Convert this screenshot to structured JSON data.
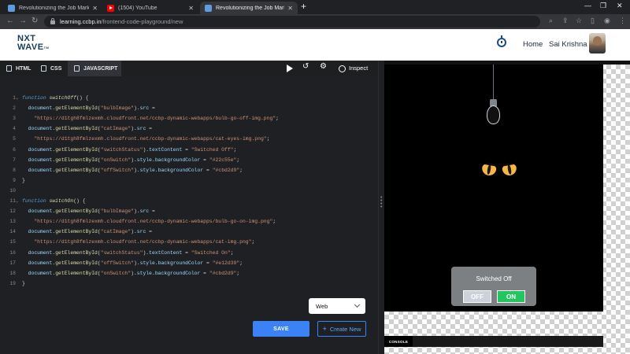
{
  "browser": {
    "tabs": [
      {
        "title": "Revolutionizing the Job Market |",
        "favicon": "ccbp-icon",
        "active": false
      },
      {
        "title": "(1504) YouTube",
        "favicon": "youtube-icon",
        "active": false
      },
      {
        "title": "Revolutionizing the Job Market |",
        "favicon": "ccbp-icon",
        "active": true
      }
    ],
    "url_host": "learning.ccbp.in",
    "url_path": "/frontend-code-playground/new"
  },
  "header": {
    "logo_line1": "NXT",
    "logo_line2": "WAVE",
    "logo_tm": "TM",
    "home_label": "Home",
    "user_name": "Sai Krishna"
  },
  "editor": {
    "tabs": [
      {
        "label": "HTML",
        "active": false
      },
      {
        "label": "CSS",
        "active": false
      },
      {
        "label": "JAVASCRIPT",
        "active": true
      }
    ],
    "inspect_label": "Inspect",
    "language_selected": "Web",
    "save_label": "SAVE",
    "create_new_label": "Create New",
    "lines": [
      {
        "n": "1",
        "fold": "⌄",
        "tokens": [
          [
            "kw",
            "function "
          ],
          [
            "fn",
            "switchOff"
          ],
          [
            "pl",
            "() {"
          ]
        ]
      },
      {
        "n": "2",
        "fold": "",
        "tokens": [
          [
            "pl",
            "  "
          ],
          [
            "vr",
            "document"
          ],
          [
            "pl",
            "."
          ],
          [
            "mt",
            "getElementById"
          ],
          [
            "pl",
            "("
          ],
          [
            "st",
            "\"bulbImage\""
          ],
          [
            "pl",
            ")."
          ],
          [
            "vr",
            "src"
          ],
          [
            "pl",
            " ="
          ]
        ]
      },
      {
        "n": "3",
        "fold": "",
        "tokens": [
          [
            "pl",
            "    "
          ],
          [
            "st",
            "\"https://d1tgh8fmlzexmh.cloudfront.net/ccbp-dynamic-webapps/bulb-go-off-img.png\""
          ],
          [
            "pl",
            ";"
          ]
        ]
      },
      {
        "n": "4",
        "fold": "",
        "tokens": [
          [
            "pl",
            "  "
          ],
          [
            "vr",
            "document"
          ],
          [
            "pl",
            "."
          ],
          [
            "mt",
            "getElementById"
          ],
          [
            "pl",
            "("
          ],
          [
            "st",
            "\"catImage\""
          ],
          [
            "pl",
            ")."
          ],
          [
            "vr",
            "src"
          ],
          [
            "pl",
            " ="
          ]
        ]
      },
      {
        "n": "5",
        "fold": "",
        "tokens": [
          [
            "pl",
            "    "
          ],
          [
            "st",
            "\"https://d1tgh8fmlzexmh.cloudfront.net/ccbp-dynamic-webapps/cat-eyes-img.png\""
          ],
          [
            "pl",
            ";"
          ]
        ]
      },
      {
        "n": "6",
        "fold": "",
        "tokens": [
          [
            "pl",
            "  "
          ],
          [
            "vr",
            "document"
          ],
          [
            "pl",
            "."
          ],
          [
            "mt",
            "getElementById"
          ],
          [
            "pl",
            "("
          ],
          [
            "st",
            "\"switchStatus\""
          ],
          [
            "pl",
            ")."
          ],
          [
            "vr",
            "textContent"
          ],
          [
            "pl",
            " = "
          ],
          [
            "st",
            "\"Switched Off\""
          ],
          [
            "pl",
            ";"
          ]
        ]
      },
      {
        "n": "7",
        "fold": "",
        "tokens": [
          [
            "pl",
            "  "
          ],
          [
            "vr",
            "document"
          ],
          [
            "pl",
            "."
          ],
          [
            "mt",
            "getElementById"
          ],
          [
            "pl",
            "("
          ],
          [
            "st",
            "\"onSwitch\""
          ],
          [
            "pl",
            ")."
          ],
          [
            "vr",
            "style"
          ],
          [
            "pl",
            "."
          ],
          [
            "vr",
            "backgroundColor"
          ],
          [
            "pl",
            " = "
          ],
          [
            "st",
            "\"#22c55e\""
          ],
          [
            "pl",
            ";"
          ]
        ]
      },
      {
        "n": "8",
        "fold": "",
        "tokens": [
          [
            "pl",
            "  "
          ],
          [
            "vr",
            "document"
          ],
          [
            "pl",
            "."
          ],
          [
            "mt",
            "getElementById"
          ],
          [
            "pl",
            "("
          ],
          [
            "st",
            "\"offSwitch\""
          ],
          [
            "pl",
            ")."
          ],
          [
            "vr",
            "style"
          ],
          [
            "pl",
            "."
          ],
          [
            "vr",
            "backgroundColor"
          ],
          [
            "pl",
            " = "
          ],
          [
            "st",
            "\"#cbd2d9\""
          ],
          [
            "pl",
            ";"
          ]
        ]
      },
      {
        "n": "9",
        "fold": "",
        "tokens": [
          [
            "pl",
            "}"
          ]
        ]
      },
      {
        "n": "10",
        "fold": "",
        "tokens": []
      },
      {
        "n": "11",
        "fold": "⌄",
        "tokens": [
          [
            "kw",
            "function "
          ],
          [
            "fn",
            "switchOn"
          ],
          [
            "pl",
            "() {"
          ]
        ]
      },
      {
        "n": "12",
        "fold": "",
        "tokens": [
          [
            "pl",
            "  "
          ],
          [
            "vr",
            "document"
          ],
          [
            "pl",
            "."
          ],
          [
            "mt",
            "getElementById"
          ],
          [
            "pl",
            "("
          ],
          [
            "st",
            "\"bulbImage\""
          ],
          [
            "pl",
            ")."
          ],
          [
            "vr",
            "src"
          ],
          [
            "pl",
            " ="
          ]
        ]
      },
      {
        "n": "13",
        "fold": "",
        "tokens": [
          [
            "pl",
            "    "
          ],
          [
            "st",
            "\"https://d1tgh8fmlzexmh.cloudfront.net/ccbp-dynamic-webapps/bulb-go-on-img.png\""
          ],
          [
            "pl",
            ";"
          ]
        ]
      },
      {
        "n": "14",
        "fold": "",
        "tokens": [
          [
            "pl",
            "  "
          ],
          [
            "vr",
            "document"
          ],
          [
            "pl",
            "."
          ],
          [
            "mt",
            "getElementById"
          ],
          [
            "pl",
            "("
          ],
          [
            "st",
            "\"catImage\""
          ],
          [
            "pl",
            ")."
          ],
          [
            "vr",
            "src"
          ],
          [
            "pl",
            " ="
          ]
        ]
      },
      {
        "n": "15",
        "fold": "",
        "tokens": [
          [
            "pl",
            "    "
          ],
          [
            "st",
            "\"https://d1tgh8fmlzexmh.cloudfront.net/ccbp-dynamic-webapps/cat-img.png\""
          ],
          [
            "pl",
            ";"
          ]
        ]
      },
      {
        "n": "16",
        "fold": "",
        "tokens": [
          [
            "pl",
            "  "
          ],
          [
            "vr",
            "document"
          ],
          [
            "pl",
            "."
          ],
          [
            "mt",
            "getElementById"
          ],
          [
            "pl",
            "("
          ],
          [
            "st",
            "\"switchStatus\""
          ],
          [
            "pl",
            ")."
          ],
          [
            "vr",
            "textContent"
          ],
          [
            "pl",
            " = "
          ],
          [
            "st",
            "\"Switched On\""
          ],
          [
            "pl",
            ";"
          ]
        ]
      },
      {
        "n": "17",
        "fold": "",
        "tokens": [
          [
            "pl",
            "  "
          ],
          [
            "vr",
            "document"
          ],
          [
            "pl",
            "."
          ],
          [
            "mt",
            "getElementById"
          ],
          [
            "pl",
            "("
          ],
          [
            "st",
            "\"offSwitch\""
          ],
          [
            "pl",
            ")."
          ],
          [
            "vr",
            "style"
          ],
          [
            "pl",
            "."
          ],
          [
            "vr",
            "backgroundColor"
          ],
          [
            "pl",
            " = "
          ],
          [
            "st",
            "\"#e12d39\""
          ],
          [
            "pl",
            ";"
          ]
        ]
      },
      {
        "n": "18",
        "fold": "",
        "tokens": [
          [
            "pl",
            "  "
          ],
          [
            "vr",
            "document"
          ],
          [
            "pl",
            "."
          ],
          [
            "mt",
            "getElementById"
          ],
          [
            "pl",
            "("
          ],
          [
            "st",
            "\"onSwitch\""
          ],
          [
            "pl",
            ")."
          ],
          [
            "vr",
            "style"
          ],
          [
            "pl",
            "."
          ],
          [
            "vr",
            "backgroundColor"
          ],
          [
            "pl",
            " = "
          ],
          [
            "st",
            "\"#cbd2d9\""
          ],
          [
            "pl",
            ";"
          ]
        ]
      },
      {
        "n": "19",
        "fold": "",
        "tokens": [
          [
            "pl",
            "}"
          ]
        ]
      }
    ]
  },
  "preview": {
    "switch_status": "Switched Off",
    "off_label": "OFF",
    "on_label": "ON",
    "console_label": "CONSOLE",
    "colors": {
      "on_button": "#22c55e",
      "off_button": "#cbd2d9",
      "cat_eyes": "#f6b748"
    }
  }
}
